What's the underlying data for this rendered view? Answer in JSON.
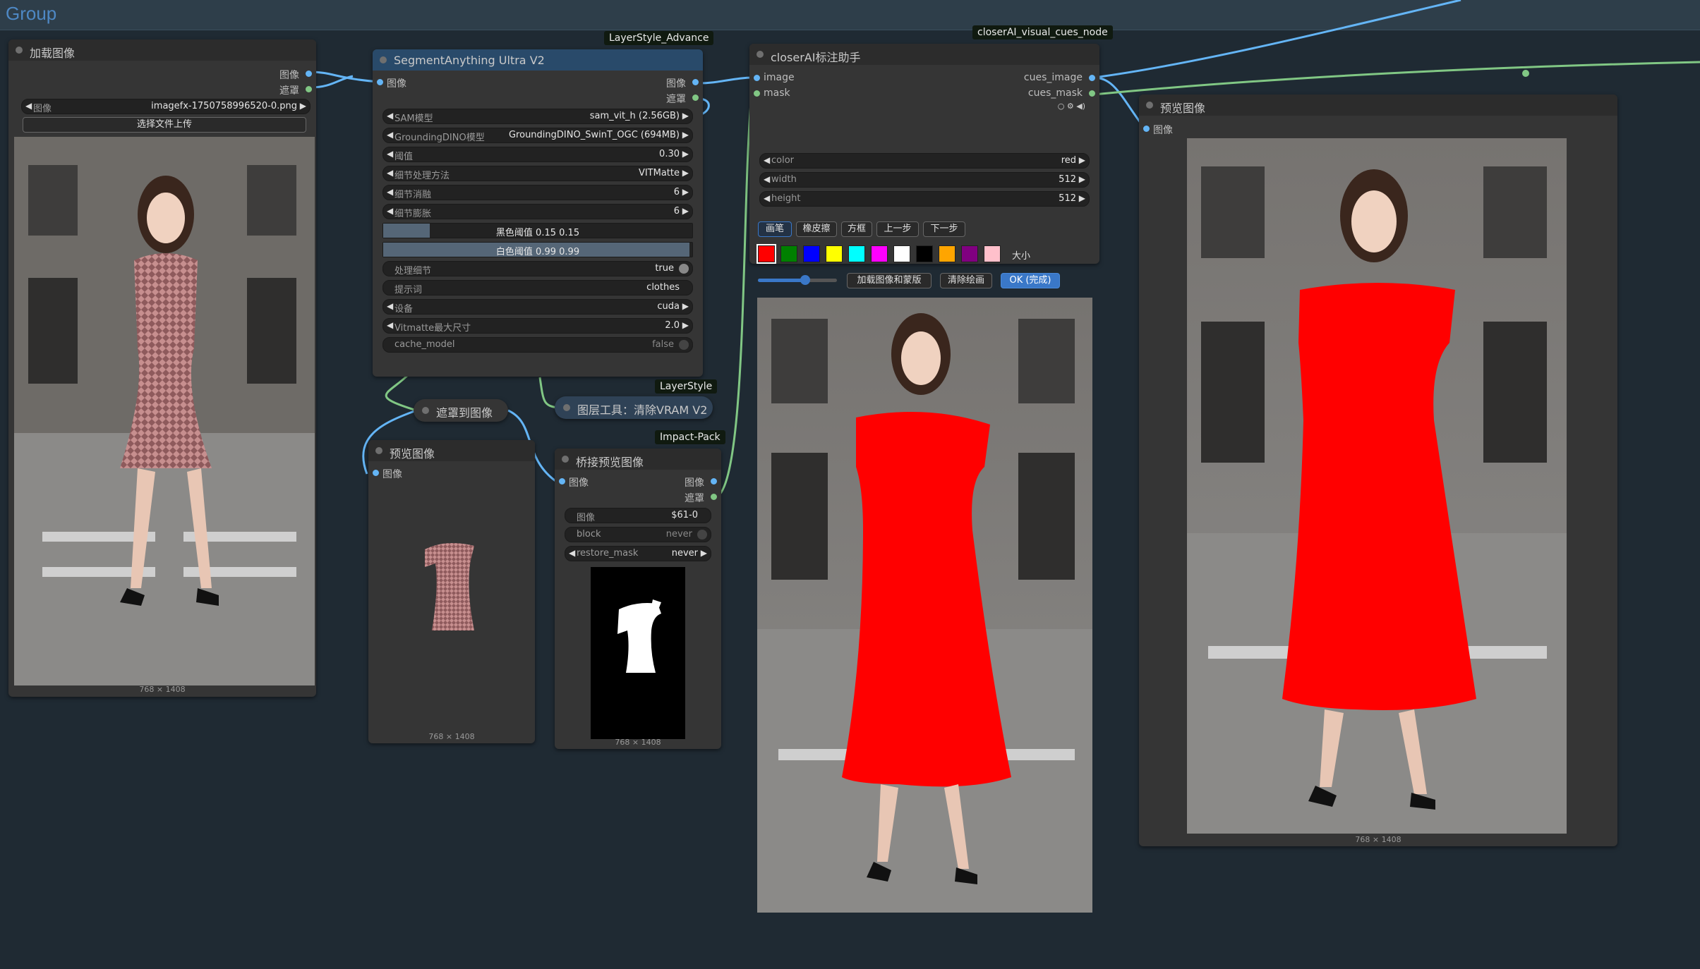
{
  "group": {
    "title": "Group"
  },
  "colors": {
    "canvas_bg": "#1f2a33",
    "image_port": "#64b5f6",
    "mask_port": "#81c784",
    "mask_paint": "#ff0000",
    "button_active": "#3a78c8"
  },
  "load_image": {
    "title": "加载图像",
    "out_image": "图像",
    "out_mask": "遮罩",
    "widget_label": "图像",
    "widget_value": "imagefx-1750758996520-0.png",
    "upload_button": "选择文件上传",
    "dims": "768 × 1408"
  },
  "sam": {
    "tag": "LayerStyle_Advance",
    "title": "SegmentAnything Ultra V2",
    "in_image": "图像",
    "out_image": "图像",
    "out_mask": "遮罩",
    "widgets": [
      {
        "label": "SAM模型",
        "value": "sam_vit_h (2.56GB)"
      },
      {
        "label": "GroundingDINO模型",
        "value": "GroundingDINO_SwinT_OGC (694MB)"
      },
      {
        "label": "阈值",
        "value": "0.30"
      },
      {
        "label": "细节处理方法",
        "value": "VITMatte"
      },
      {
        "label": "细节消融",
        "value": "6"
      },
      {
        "label": "细节膨胀",
        "value": "6"
      }
    ],
    "black_threshold": {
      "label": "黑色阈值",
      "value": "0.15",
      "fill": 0.15
    },
    "white_threshold": {
      "label": "白色阈值",
      "value": "0.99",
      "fill": 0.99
    },
    "detail": {
      "label": "处理细节",
      "value": "true"
    },
    "prompt": {
      "label": "提示词",
      "value": "clothes"
    },
    "device": {
      "label": "设备",
      "value": "cuda"
    },
    "vitmatte_max": {
      "label": "Vitmatte最大尺寸",
      "value": "2.0"
    },
    "cache_model": {
      "label": "cache_model",
      "value": "false"
    }
  },
  "mask_to_image": {
    "title": "遮罩到图像"
  },
  "vram": {
    "tag": "LayerStyle",
    "title": "图层工具：清除VRAM V2"
  },
  "preview_small": {
    "title": "预览图像",
    "in_image": "图像",
    "dims": "768 × 1408"
  },
  "bridge": {
    "tag": "Impact-Pack",
    "title": "桥接预览图像",
    "in_image": "图像",
    "out_image": "图像",
    "out_mask": "遮罩",
    "image_widget": {
      "label": "图像",
      "value": "$61-0"
    },
    "block": {
      "label": "block",
      "value": "never"
    },
    "restore_mask": {
      "label": "restore_mask",
      "value": "never"
    },
    "dims": "768 × 1408"
  },
  "closer": {
    "tag": "closerAI_visual_cues_node",
    "title": "closerAI标注助手",
    "in_image": "image",
    "in_mask": "mask",
    "out_image": "cues_image",
    "out_mask": "cues_mask",
    "color": {
      "label": "color",
      "value": "red"
    },
    "width": {
      "label": "width",
      "value": "512"
    },
    "height": {
      "label": "height",
      "value": "512"
    },
    "tools": [
      "画笔",
      "橡皮擦",
      "方框",
      "上一步",
      "下一步"
    ],
    "palette": [
      "#ff0000",
      "#008000",
      "#0000ff",
      "#ffff00",
      "#00ffff",
      "#ff00ff",
      "#ffffff",
      "#000000",
      "#ffa500",
      "#800080",
      "#ffc0cb"
    ],
    "size_label": "大小",
    "brush_size": 0.6,
    "load_button": "加载图像和蒙版",
    "clear_button": "清除绘画",
    "ok_button": "OK (完成)"
  },
  "preview_large": {
    "title": "预览图像",
    "in_image": "图像",
    "dims": "768 × 1408"
  }
}
